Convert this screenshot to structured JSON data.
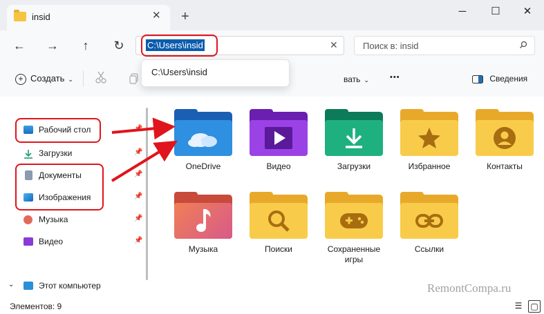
{
  "window": {
    "tab_title": "insid",
    "new_tab": "+",
    "close_tab": "✕",
    "minimize": "─",
    "maximize": "☐",
    "close": "✕"
  },
  "nav": {
    "back": "←",
    "forward": "→",
    "up": "↑",
    "refresh": "↻"
  },
  "address": {
    "value": "C:\\Users\\insid",
    "clear": "✕",
    "suggestion": "C:\\Users\\insid"
  },
  "search": {
    "placeholder": "Поиск в: insid"
  },
  "toolbar": {
    "create": "Создать",
    "partial_label": "вать",
    "more": "•••",
    "details": "Сведения"
  },
  "sidebar": {
    "items": [
      {
        "label": "Рабочий стол",
        "icon": "desktop-icon"
      },
      {
        "label": "Загрузки",
        "icon": "download-icon"
      },
      {
        "label": "Документы",
        "icon": "documents-icon"
      },
      {
        "label": "Изображения",
        "icon": "pictures-icon"
      },
      {
        "label": "Музыка",
        "icon": "music-icon"
      },
      {
        "label": "Видео",
        "icon": "video-icon"
      }
    ],
    "this_pc": "Этот компьютер"
  },
  "folders": [
    {
      "label": "OneDrive",
      "icon": "cloud-icon"
    },
    {
      "label": "Видео",
      "icon": "play-icon"
    },
    {
      "label": "Загрузки",
      "icon": "download-arrow-icon"
    },
    {
      "label": "Избранное",
      "icon": "star-icon"
    },
    {
      "label": "Контакты",
      "icon": "contact-icon"
    },
    {
      "label": "Музыка",
      "icon": "music-note-icon"
    },
    {
      "label": "Поиски",
      "icon": "magnifier-icon"
    },
    {
      "label": "Сохраненные\nигры",
      "icon": "gamepad-icon"
    },
    {
      "label": "Ссылки",
      "icon": "link-icon"
    }
  ],
  "status": {
    "items_count": "Элементов: 9"
  },
  "watermark": "RemontCompa.ru",
  "colors": {
    "highlight": "#e0141c",
    "selection": "#0b5cad",
    "folder_yellow": "#f5c542"
  }
}
